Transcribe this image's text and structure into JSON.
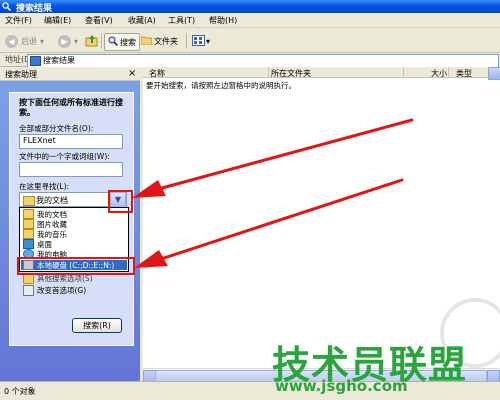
{
  "window": {
    "title": "搜索结果"
  },
  "menu": [
    "文件(F)",
    "编辑(E)",
    "查看(V)",
    "收藏(A)",
    "工具(T)",
    "帮助(H)"
  ],
  "toolbar": {
    "back": "后退",
    "search": "搜索",
    "folders": "文件夹"
  },
  "address": {
    "label": "地址(D)",
    "value": "搜索结果"
  },
  "pane": {
    "title": "搜索助理",
    "close": "×",
    "heading": "按下面任何或所有标准进行搜索。",
    "name_label": "全部或部分文件名(O):",
    "name_value": "FLEXnet",
    "word_label": "文件中的一个字或词组(W):",
    "word_value": "",
    "lookin_label": "在这里寻找(L):",
    "lookin_value": "我的文档",
    "dropdown_items": [
      {
        "label": "我的文档",
        "icon": "folder-icon"
      },
      {
        "label": "图片收藏",
        "icon": "folder-icon"
      },
      {
        "label": "我的音乐",
        "icon": "folder-icon"
      },
      {
        "label": "桌面",
        "icon": "desktop-icon"
      },
      {
        "label": "我的电脑",
        "icon": "computer-icon"
      },
      {
        "label": "本地硬盘 (C:;D:;E:;N:)",
        "icon": "drive-icon"
      }
    ],
    "more_options": "其他搜索选项(S)",
    "change_prefs": "改变首选项(G)",
    "search_button": "搜索(R)"
  },
  "results": {
    "columns": [
      "名称",
      "所在文件夹",
      "大小",
      "类型"
    ],
    "message": "要开始搜索，请按照左边窗格中的说明执行。"
  },
  "status": {
    "text": "0 个对象"
  },
  "watermark": {
    "text": "技术员联盟",
    "url": "www.jsgho.com"
  },
  "colors": {
    "titlebar": "#0055e5",
    "pane": "#6f8fdf",
    "highlight": "#e11515",
    "watermark": "#2aa53d",
    "selection": "#316ac5"
  }
}
